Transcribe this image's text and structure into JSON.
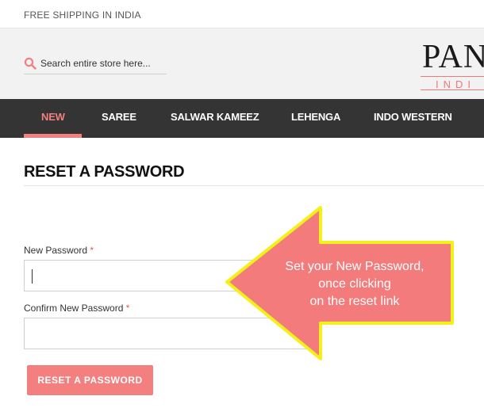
{
  "topbar": {
    "shipping_text": "FREE SHIPPING IN INDIA"
  },
  "search": {
    "placeholder": "Search entire store here..."
  },
  "logo": {
    "main_text": "PAN",
    "sub_text": "INDI"
  },
  "nav": {
    "items": [
      {
        "label": "NEW",
        "active": true
      },
      {
        "label": "SAREE",
        "active": false
      },
      {
        "label": "SALWAR KAMEEZ",
        "active": false
      },
      {
        "label": "LEHENGA",
        "active": false
      },
      {
        "label": "INDO WESTERN",
        "active": false
      }
    ]
  },
  "page": {
    "title": "RESET A PASSWORD"
  },
  "form": {
    "new_password_label": "New Password",
    "confirm_password_label": "Confirm New Password",
    "required_mark": "*",
    "new_password_value": "",
    "confirm_password_value": "",
    "submit_label": "RESET A PASSWORD"
  },
  "annotation": {
    "lines": [
      "Set your New Password,",
      "once clicking",
      "on the reset link"
    ]
  },
  "colors": {
    "accent": "#f37f7f",
    "nav_bg": "#343434",
    "callout_fill": "#f47b7b",
    "callout_border": "#f2f21a"
  }
}
